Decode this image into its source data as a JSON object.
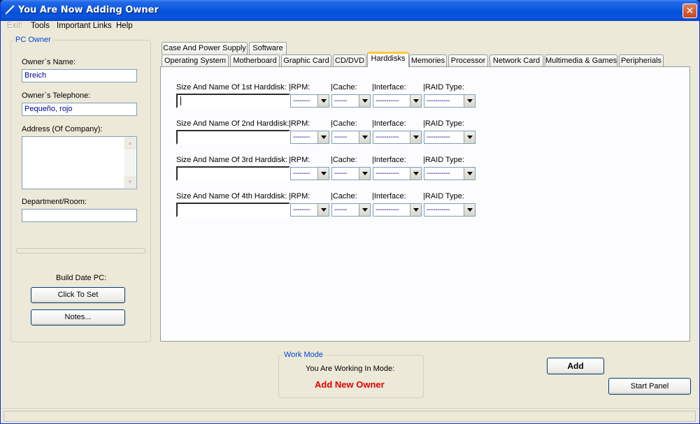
{
  "window": {
    "title": "You Are Now Adding Owner",
    "close": "✕"
  },
  "menu": [
    {
      "label": "Exit!",
      "disabled": true
    },
    {
      "label": "Tools"
    },
    {
      "label": "Important Links"
    },
    {
      "label": "Help"
    }
  ],
  "owner": {
    "group_title": "PC Owner",
    "name_label": "Owner`s Name:",
    "name_value": "Breich",
    "phone_label": "Owner`s Telephone:",
    "phone_value": "Pequeño, rojo",
    "address_label": "Address (Of Company):",
    "address_value": "",
    "dept_label": "Department/Room:",
    "dept_value": "",
    "build_date_label": "Build Date PC:",
    "set_button": "Click To Set",
    "notes_button": "Notes..."
  },
  "tabs_row1": [
    "Case And Power Supply",
    "Software"
  ],
  "tabs_row2": [
    "Operating System",
    "Motherboard",
    "Graphic Card",
    "CD/DVD",
    "Harddisks",
    "Memories",
    "Processor",
    "Network Card",
    "Multimedia & Games",
    "Peripherials"
  ],
  "active_tab": "Harddisks",
  "harddisks": {
    "headers": {
      "rpm": "|RPM:",
      "cache": "|Cache:",
      "interface": "|Interface:",
      "raid": "|RAID Type:"
    },
    "rows": [
      {
        "label": "Size And Name Of 1st Harddisk:",
        "value": "",
        "rpm": "--------",
        "cache": "------",
        "interface": "-----------",
        "raid": "-----------"
      },
      {
        "label": "Size And Name Of 2nd Harddisk:",
        "value": "",
        "rpm": "--------",
        "cache": "------",
        "interface": "-----------",
        "raid": "-----------"
      },
      {
        "label": "Size And Name Of 3rd Harddisk:",
        "value": "",
        "rpm": "--------",
        "cache": "------",
        "interface": "-----------",
        "raid": "-----------"
      },
      {
        "label": "Size And Name Of 4th Harddisk:",
        "value": "",
        "rpm": "--------",
        "cache": "------",
        "interface": "-----------",
        "raid": "-----------"
      }
    ]
  },
  "workmode": {
    "group_title": "Work Mode",
    "label": "You Are Working In Mode:",
    "value": "Add New Owner"
  },
  "actions": {
    "add": "Add",
    "start_panel": "Start Panel"
  },
  "colors": {
    "titlebar": "#0a5ae0",
    "mode_text": "#e00000",
    "group_label": "#0046d5",
    "active_tab_accent": "#ffc83c"
  }
}
